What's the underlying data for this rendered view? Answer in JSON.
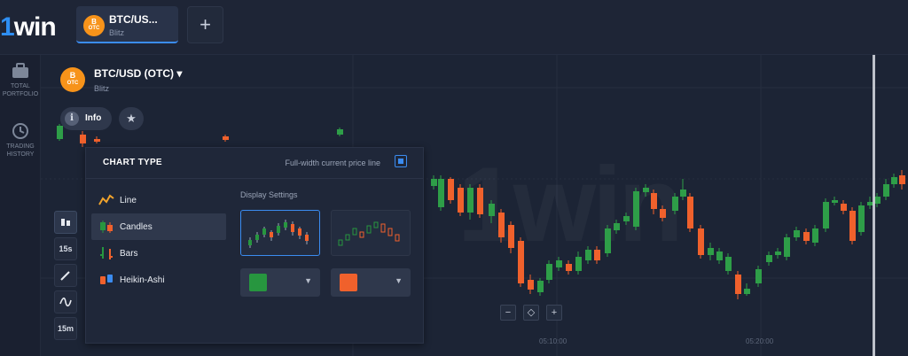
{
  "app": {
    "logo_one": "1",
    "logo_win": "win"
  },
  "tab": {
    "title": "BTC/US...",
    "subtitle": "Blitz",
    "coin_label": "OTC",
    "coin_symbol": "B"
  },
  "add_tab": {
    "label": "+"
  },
  "sidebar": {
    "items": [
      {
        "label_1": "TOTAL",
        "label_2": "PORTFOLIO",
        "icon": "briefcase-icon"
      },
      {
        "label_1": "TRADING",
        "label_2": "HISTORY",
        "icon": "history-clock-icon"
      }
    ]
  },
  "asset": {
    "name": "BTC/USD (OTC) ▾",
    "subtitle": "Blitz",
    "coin_label": "OTC",
    "coin_symbol": "B"
  },
  "info_button": {
    "label": "Info",
    "glyph": "i"
  },
  "star_button": {
    "glyph": "★"
  },
  "watermark": "1win",
  "tools": [
    {
      "label": "",
      "icon": "candles-type-icon"
    },
    {
      "label": "15s"
    },
    {
      "label": "",
      "icon": "pen-icon"
    },
    {
      "label": "",
      "icon": "wave-icon"
    },
    {
      "label": "15m"
    }
  ],
  "chart_type_panel": {
    "title": "CHART TYPE",
    "full_width_label": "Full-width current price line",
    "display_settings_label": "Display Settings",
    "types": [
      {
        "label": "Line",
        "icon": "line-chart-icon"
      },
      {
        "label": "Candles",
        "icon": "candles-icon"
      },
      {
        "label": "Bars",
        "icon": "bars-icon"
      },
      {
        "label": "Heikin-Ashi",
        "icon": "heikin-ashi-icon"
      }
    ],
    "selected_type": "Candles",
    "up_color": "#27963f",
    "down_color": "#f0612c"
  },
  "zoom": {
    "minus": "−",
    "reset": "◇",
    "plus": "+"
  },
  "time_labels": [
    "05:10:00",
    "05:20:00"
  ],
  "colors": {
    "accent": "#3b8cf0",
    "up": "#2e9e48",
    "down": "#f0612c",
    "background": "#1c2435"
  }
}
